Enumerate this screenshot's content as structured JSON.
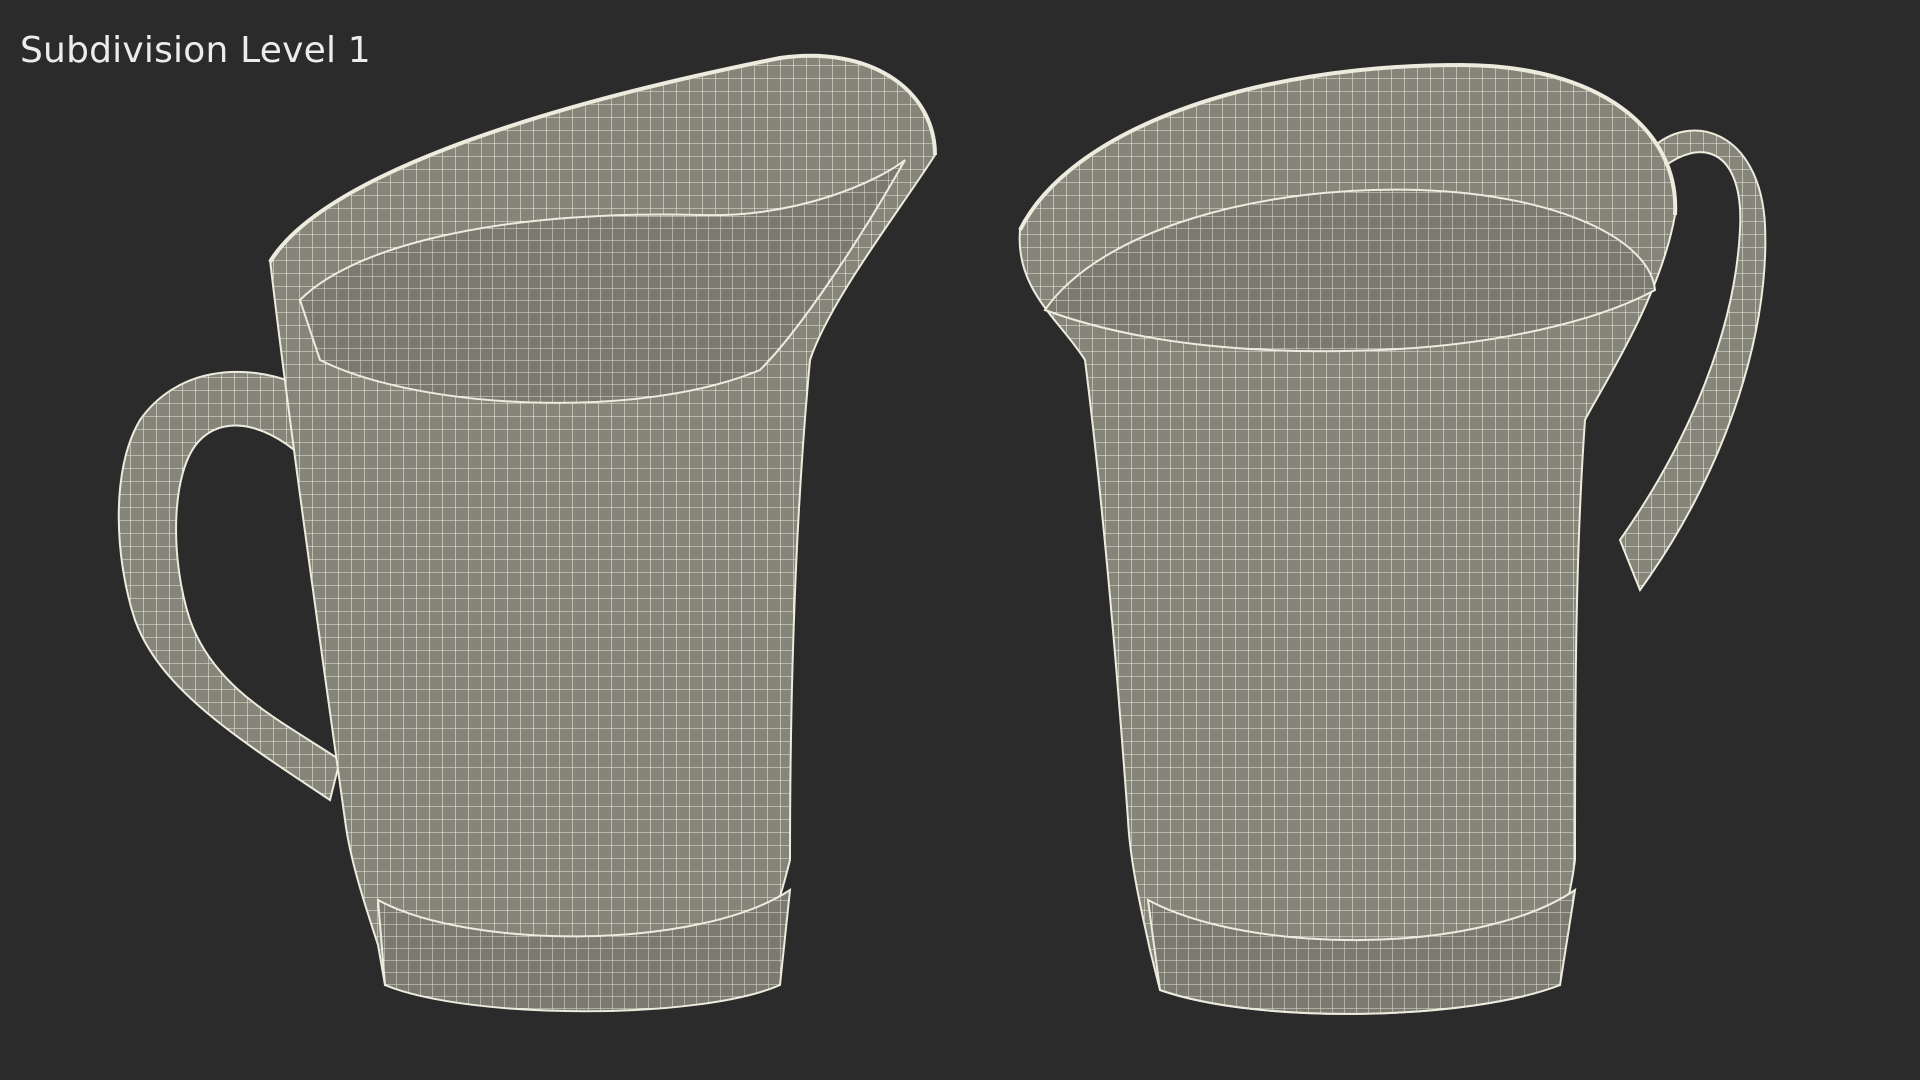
{
  "render": {
    "label": "Subdivision Level 1"
  },
  "colors": {
    "background": "#2b2b2b",
    "mesh_fill": "#86857a",
    "wire": "#ecebdd",
    "label_text": "#ececec"
  }
}
